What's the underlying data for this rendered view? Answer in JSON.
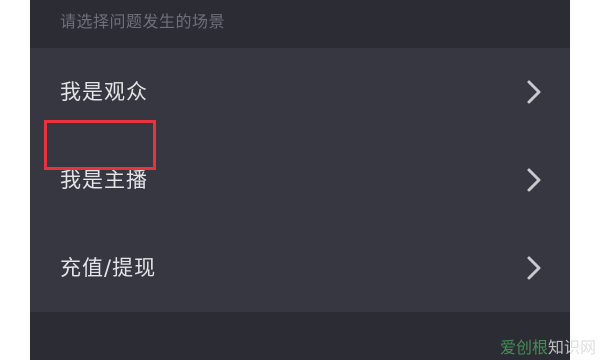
{
  "header": {
    "hint": "请选择问题发生的场景"
  },
  "menu": {
    "items": [
      {
        "label": "我是观众",
        "icon": "chevron-right-icon"
      },
      {
        "label": "我是主播",
        "icon": "chevron-right-icon",
        "highlighted": true
      },
      {
        "label": "充值/提现",
        "icon": "chevron-right-icon"
      }
    ]
  },
  "annotation": {
    "highlight_color": "#e8333d"
  },
  "watermark": {
    "text_a": "爱创根",
    "text_b": "知识网"
  },
  "colors": {
    "background": "#2b2c34",
    "menu_background": "#363741",
    "text": "#e4e4e6",
    "hint_text": "#6e7079"
  }
}
